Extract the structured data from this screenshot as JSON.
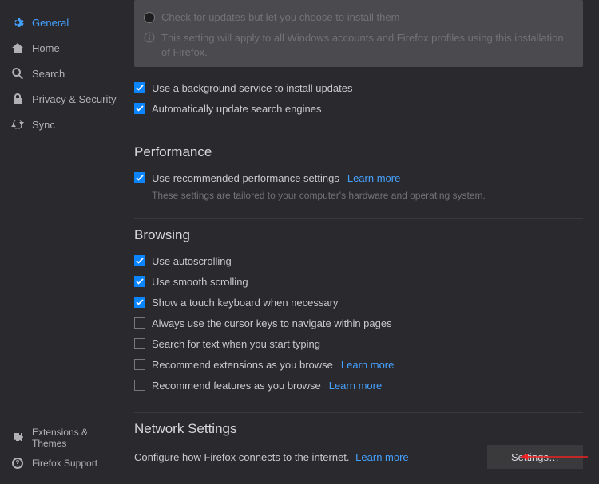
{
  "sidebar": {
    "items": [
      {
        "label": "General"
      },
      {
        "label": "Home"
      },
      {
        "label": "Search"
      },
      {
        "label": "Privacy & Security"
      },
      {
        "label": "Sync"
      }
    ],
    "footer": [
      {
        "label": "Extensions & Themes"
      },
      {
        "label": "Firefox Support"
      }
    ]
  },
  "updates": {
    "radio_label": "Check for updates but let you choose to install them",
    "note": "This setting will apply to all Windows accounts and Firefox profiles using this installation of Firefox.",
    "bg_service": "Use a background service to install updates",
    "auto_search": "Automatically update search engines"
  },
  "performance": {
    "title": "Performance",
    "recommended": "Use recommended performance settings",
    "learn_more": "Learn more",
    "note": "These settings are tailored to your computer's hardware and operating system."
  },
  "browsing": {
    "title": "Browsing",
    "autoscroll": "Use autoscrolling",
    "smooth": "Use smooth scrolling",
    "touch": "Show a touch keyboard when necessary",
    "cursor_keys": "Always use the cursor keys to navigate within pages",
    "search_type": "Search for text when you start typing",
    "rec_ext": "Recommend extensions as you browse",
    "rec_feat": "Recommend features as you browse",
    "learn_more": "Learn more"
  },
  "network": {
    "title": "Network Settings",
    "desc": "Configure how Firefox connects to the internet.",
    "learn_more": "Learn more",
    "settings_btn": "Settings…"
  }
}
